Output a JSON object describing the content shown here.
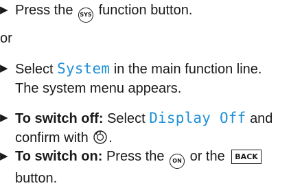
{
  "steps": {
    "step1": {
      "before": "Press the",
      "button": "SYS",
      "after": "function button."
    },
    "or": "or",
    "step2": {
      "before": "Select",
      "code": "System",
      "after": "in the main function line.",
      "line2": "The system menu appears."
    },
    "step3": {
      "bold": "To switch off:",
      "before": "Select",
      "code": "Display Off",
      "after": "and",
      "line2_before": "confirm with",
      "line2_after": "."
    },
    "step4": {
      "bold": "To switch on:",
      "before": "Press the",
      "on_button": "ON",
      "middle": "or the",
      "back_button": "BACK",
      "line2": "button."
    }
  },
  "icons": {
    "arrow": "right-triangle-bullet",
    "confirm": "controller-knob-icon"
  }
}
